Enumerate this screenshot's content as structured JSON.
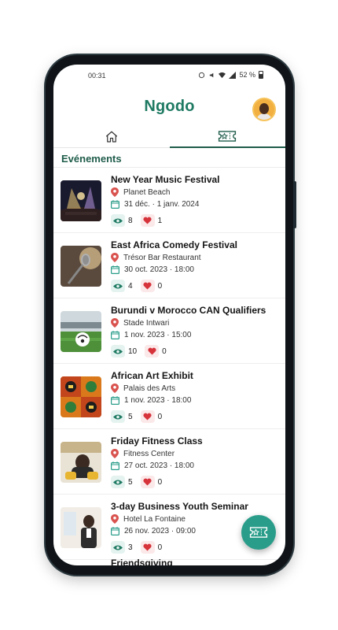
{
  "status_bar": {
    "time": "00:31",
    "battery": "52 %"
  },
  "app": {
    "logo": "Ngodo"
  },
  "tabs": [
    {
      "name": "home",
      "icon": "home-icon"
    },
    {
      "name": "events",
      "icon": "ticket-icon"
    }
  ],
  "section": {
    "title": "Evénements"
  },
  "events": [
    {
      "title": "New Year Music Festival",
      "place": "Planet Beach",
      "date": "31 déc. · 1 janv. 2024",
      "views": "8",
      "likes": "1"
    },
    {
      "title": "East Africa Comedy Festival",
      "place": "Trésor Bar Restaurant",
      "date": "30 oct. 2023 · 18:00",
      "views": "4",
      "likes": "0"
    },
    {
      "title": "Burundi v Morocco CAN Qualifiers",
      "place": "Stade Intwari",
      "date": "1 nov. 2023 · 15:00",
      "views": "10",
      "likes": "0"
    },
    {
      "title": "African Art Exhibit",
      "place": "Palais des Arts",
      "date": "1 nov. 2023 · 18:00",
      "views": "5",
      "likes": "0"
    },
    {
      "title": "Friday Fitness Class",
      "place": "Fitness Center",
      "date": "27 oct. 2023 · 18:00",
      "views": "5",
      "likes": "0"
    },
    {
      "title": "3-day Business Youth Seminar",
      "place": "Hotel La Fontaine",
      "date": "26 nov. 2023 · 09:00",
      "views": "3",
      "likes": "0"
    }
  ],
  "partial_event": {
    "title": "Friendsgiving"
  },
  "colors": {
    "brand": "#1f7a63",
    "accent": "#2a9d8a",
    "pin": "#d9534f",
    "heart": "#d6333b"
  }
}
